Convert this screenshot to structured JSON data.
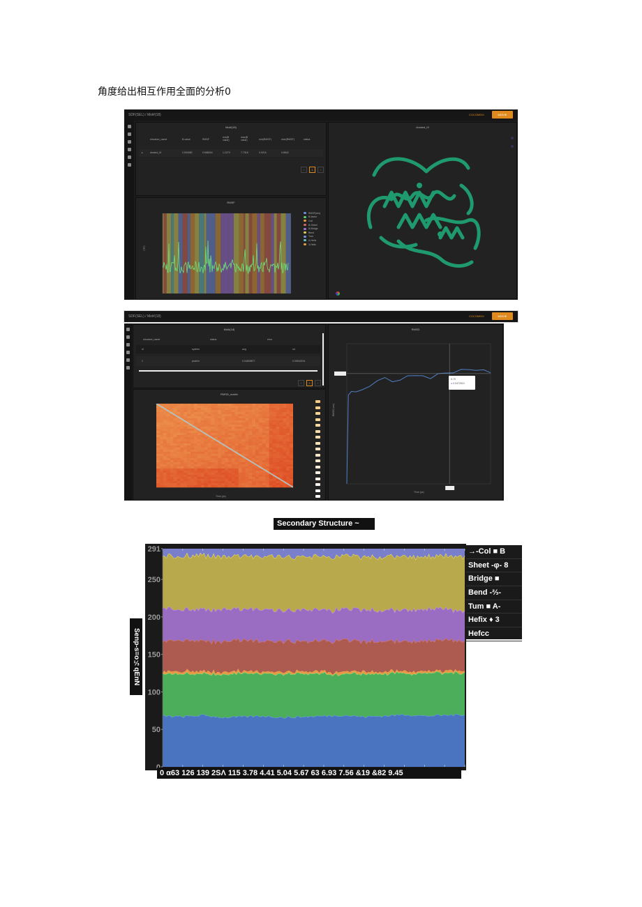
{
  "heading": "角度给出相互作用全面的分析0",
  "screenshot1": {
    "breadcrumb": "SDF(SEL) / Mol#(18)",
    "top_right_link": "COCOMEIX",
    "top_right_button": "MOVIE",
    "table_panel": {
      "title": "Mol#(18)",
      "columns": [
        "structure_name",
        "B-value",
        "RMSF",
        "min(B value)",
        "max(B value)",
        "min(RMSF)",
        "max(RMSF)",
        "status"
      ],
      "rows": [
        [
          "docked_t3",
          "2.534982",
          "0.658016",
          "1.2270",
          "7.7316",
          "0.0216",
          "0.8542",
          ""
        ]
      ],
      "page": "1"
    },
    "rmsf_panel": {
      "title": "RMSF",
      "ylabel": "(nm)",
      "legend": [
        "RMSF(res)",
        "B-factor",
        "Coil",
        "B-Sheet",
        "B-Bridge",
        "Bend",
        "Turn",
        "A-Helix",
        "3-Helix"
      ],
      "legend_colors": [
        "#6f8de0",
        "#5fd06a",
        "#e89a3a",
        "#d46a5a",
        "#a073d6",
        "#d9cf5a",
        "#7a90e0",
        "#6ac0c0",
        "#e0a040"
      ]
    },
    "structure_panel": {
      "title": "docked_t3",
      "ribbon_color": "#1f9a6e"
    }
  },
  "screenshot2": {
    "breadcrumb": "SDF(SEL) / Mol#(18)",
    "top_right_link": "COCOMEIX",
    "top_right_button": "MOVIE",
    "table_panel": {
      "title": "Mol#(18)",
      "header1": [
        "structure_name",
        "status",
        "error"
      ],
      "columns": [
        "id",
        "system",
        "avg",
        "sd"
      ],
      "rows": [
        [
          "1",
          "protein",
          "0.04659877",
          "0.00542201"
        ]
      ],
      "page": "1"
    },
    "matrix_panel": {
      "title": "RMSD_matrix",
      "xlabel": "Time (ps)"
    },
    "rmsd_panel": {
      "title": "RMSD",
      "ylabel": "RMSD (nm)",
      "xlabel": "Time (ps)",
      "line_color": "#4f7fc7",
      "tooltip_x": "6.75",
      "tooltip_y": "0.0472510",
      "points": [
        [
          0,
          0
        ],
        [
          0.1,
          0.038
        ],
        [
          0.3,
          0.04
        ],
        [
          0.6,
          0.039
        ],
        [
          1.0,
          0.041
        ],
        [
          1.5,
          0.042
        ],
        [
          2.0,
          0.044
        ],
        [
          2.5,
          0.045
        ],
        [
          3.0,
          0.043
        ],
        [
          3.5,
          0.045
        ],
        [
          4.0,
          0.047
        ],
        [
          4.5,
          0.0465
        ],
        [
          5.0,
          0.046
        ],
        [
          5.5,
          0.045
        ],
        [
          6.0,
          0.047
        ],
        [
          6.5,
          0.0475
        ],
        [
          7.0,
          0.048
        ],
        [
          7.5,
          0.0485
        ],
        [
          8.0,
          0.0488
        ],
        [
          8.5,
          0.0485
        ],
        [
          9.0,
          0.0488
        ],
        [
          9.45,
          0.047
        ]
      ],
      "ylim": [
        0,
        0.06
      ]
    }
  },
  "chart_data": {
    "type": "area",
    "title": "Secondary Structure ~",
    "ylabel": "Senp-s=o⅓qEnN",
    "xtick_text": "0 α63 126 139 2SΛ 115 3.78 4.41 5.04 5.67 63 6.93 7.56 &19 &82 9.45",
    "x": [
      0,
      0.63,
      1.26,
      1.89,
      2.52,
      3.15,
      3.78,
      4.41,
      5.04,
      5.67,
      6.3,
      6.93,
      7.56,
      8.19,
      8.82,
      9.45
    ],
    "yticks": [
      50,
      100,
      150,
      200,
      250,
      291
    ],
    "ylim": [
      0,
      291
    ],
    "stacked": true,
    "series": [
      {
        "color": "#4a74bf",
        "values": [
          68,
          67,
          69,
          66,
          67,
          68,
          66,
          67,
          68,
          69,
          67,
          68,
          70,
          68,
          69,
          70
        ]
      },
      {
        "color": "#4cae5b",
        "values": [
          56,
          57,
          55,
          58,
          57,
          57,
          58,
          57,
          56,
          55,
          57,
          56,
          55,
          57,
          56,
          55
        ]
      },
      {
        "color": "#e69a45",
        "values": [
          3,
          3,
          3,
          3,
          3,
          3,
          3,
          3,
          3,
          3,
          3,
          3,
          3,
          3,
          3,
          3
        ]
      },
      {
        "color": "#ad5b50",
        "values": [
          41,
          42,
          40,
          41,
          42,
          40,
          41,
          40,
          41,
          42,
          40,
          41,
          40,
          40,
          41,
          40
        ]
      },
      {
        "color": "#9a6cc2",
        "values": [
          44,
          41,
          42,
          43,
          41,
          43,
          41,
          42,
          42,
          41,
          43,
          41,
          42,
          43,
          41,
          40
        ]
      },
      {
        "color": "#b8a94d",
        "values": [
          70,
          71,
          72,
          70,
          71,
          70,
          72,
          71,
          71,
          71,
          70,
          72,
          71,
          70,
          70,
          73
        ]
      },
      {
        "color": "#7a7fcc",
        "values": [
          9,
          10,
          10,
          10,
          10,
          10,
          10,
          10,
          10,
          10,
          11,
          10,
          10,
          10,
          12,
          10
        ]
      }
    ],
    "legend": [
      "→-Col ■ B",
      "Sheet -φ- 8",
      "Bridge ■",
      "Bend -⅔-",
      "Tum ■ A-",
      "Hefix ♦ 3",
      "Hefcc"
    ]
  }
}
